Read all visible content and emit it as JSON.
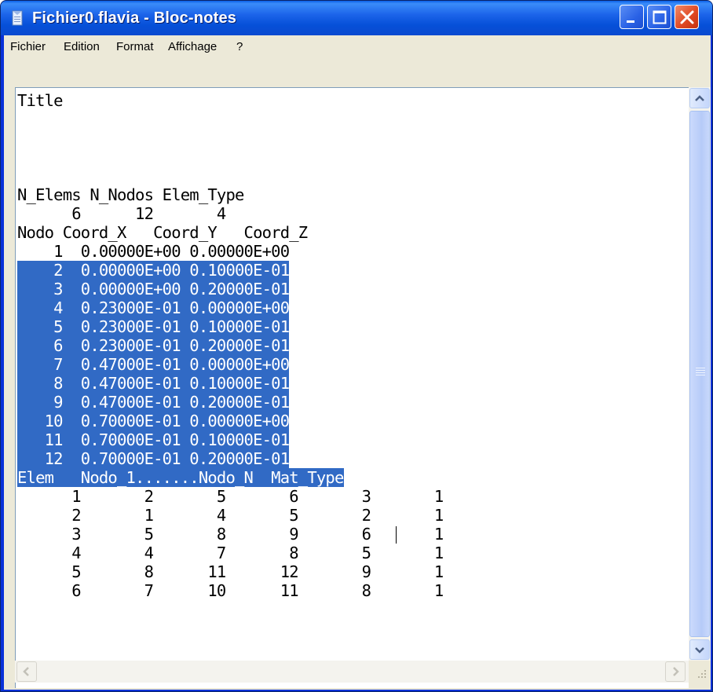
{
  "window": {
    "title": "Fichier0.flavia - Bloc-notes",
    "app_icon": "notepad-icon",
    "controls": [
      "minimize-icon",
      "maximize-icon",
      "close-icon"
    ]
  },
  "menu": [
    "Fichier",
    "Edition",
    "Format",
    "Affichage",
    "?"
  ],
  "document": {
    "lines": [
      "Title",
      "",
      "",
      "",
      "",
      "N_Elems N_Nodos Elem_Type",
      "      6      12       4",
      "Nodo Coord_X   Coord_Y   Coord_Z",
      "    1  0.00000E+00 0.00000E+00",
      "    2  0.00000E+00 0.10000E-01",
      "    3  0.00000E+00 0.20000E-01",
      "    4  0.23000E-01 0.00000E+00",
      "    5  0.23000E-01 0.10000E-01",
      "    6  0.23000E-01 0.20000E-01",
      "    7  0.47000E-01 0.00000E+00",
      "    8  0.47000E-01 0.10000E-01",
      "    9  0.47000E-01 0.20000E-01",
      "   10  0.70000E-01 0.00000E+00",
      "   11  0.70000E-01 0.10000E-01",
      "   12  0.70000E-01 0.20000E-01",
      "Elem   Nodo_1.......Nodo_N  Mat_Type",
      "      1       2       5       6       3       1",
      "      2       1       4       5       2       1",
      "      3       5       8       9       6       1",
      "      4       4       7       8       5       1",
      "      5       8      11      12       9       1",
      "      6       7      10      11       8       1"
    ],
    "selection": {
      "from_line": 9,
      "to_line": 20
    }
  },
  "scrollbars": {
    "vertical": {
      "up": "chevron-up-icon",
      "down": "chevron-down-icon"
    },
    "horizontal": {
      "left": "chevron-left-icon",
      "right": "chevron-right-icon"
    }
  },
  "colors": {
    "titlebar": "#0a4ad0",
    "selection": "#316ac5",
    "close": "#e04a24",
    "chrome": "#ece9d8"
  }
}
